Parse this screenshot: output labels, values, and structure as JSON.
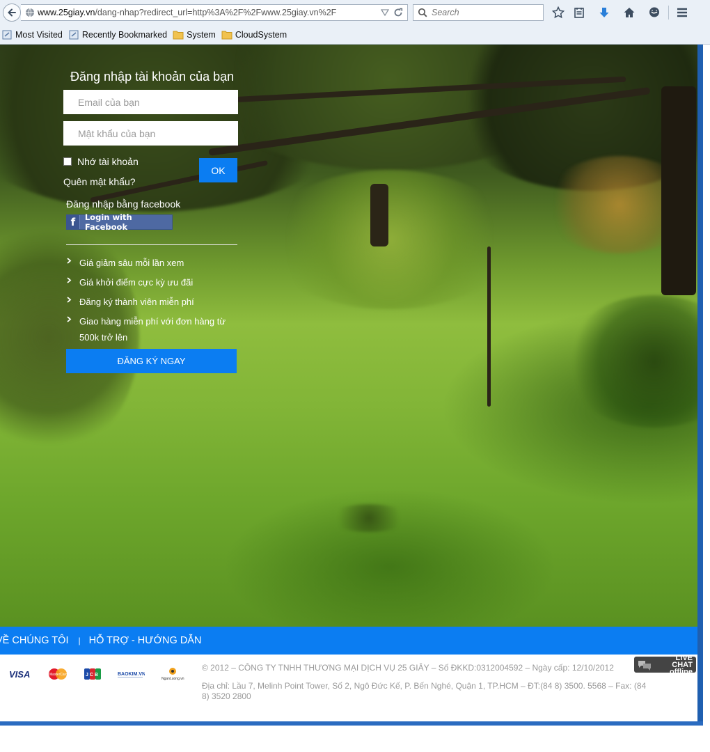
{
  "browser": {
    "url_domain": "www.25giay.vn",
    "url_path": "/dang-nhap?redirect_url=http%3A%2F%2Fwww.25giay.vn%2F",
    "search_placeholder": "Search",
    "bookmarks": [
      "Most Visited",
      "Recently Bookmarked",
      "System",
      "CloudSystem"
    ]
  },
  "login": {
    "title": "Đăng nhập tài khoản của bạn",
    "email_placeholder": "Email của bạn",
    "password_placeholder": "Mật khẩu của bạn",
    "remember_label": "Nhớ tài khoản",
    "ok_label": "OK",
    "forgot_label": "Quên mật khẩu?",
    "facebook_label": "Đăng nhập bằng facebook",
    "facebook_button": "Login with Facebook",
    "benefits": [
      "Giá giảm sâu mỗi lần xem",
      "Giá khởi điểm cực kỳ ưu đãi",
      "Đăng ký thành viên miễn phí",
      "Giao hàng miễn phí với đơn hàng từ 500k trở lên"
    ],
    "signup_label": "ĐĂNG KÝ NGAY"
  },
  "footer": {
    "nav": [
      "VỀ CHÚNG TÔI",
      "HỖ TRỢ - HƯỚNG DẪN"
    ],
    "nav_separator": "|",
    "payment_logos": [
      "VISA",
      "MasterCard",
      "JCB",
      "BAOKIM.VN",
      "NganLuong.vn"
    ],
    "copyright": "© 2012 – CÔNG TY TNHH THƯƠNG MẠI DỊCH VỤ 25 GIÂY – Số ĐKKD:0312004592 – Ngày cấp: 12/10/2012",
    "address": "Địa chỉ: Lầu 7, Melinh Point Tower, Số 2, Ngô Đức Kế, P. Bến Nghé, Quận 1, TP.HCM – ĐT:(84 8) 3500. 5568 – Fax: (84 8) 3520 2800"
  },
  "livechat": {
    "line1": "LIVE CHAT",
    "line2": "offline"
  },
  "colors": {
    "accent": "#0b7df2",
    "facebook": "#4e69a2"
  }
}
